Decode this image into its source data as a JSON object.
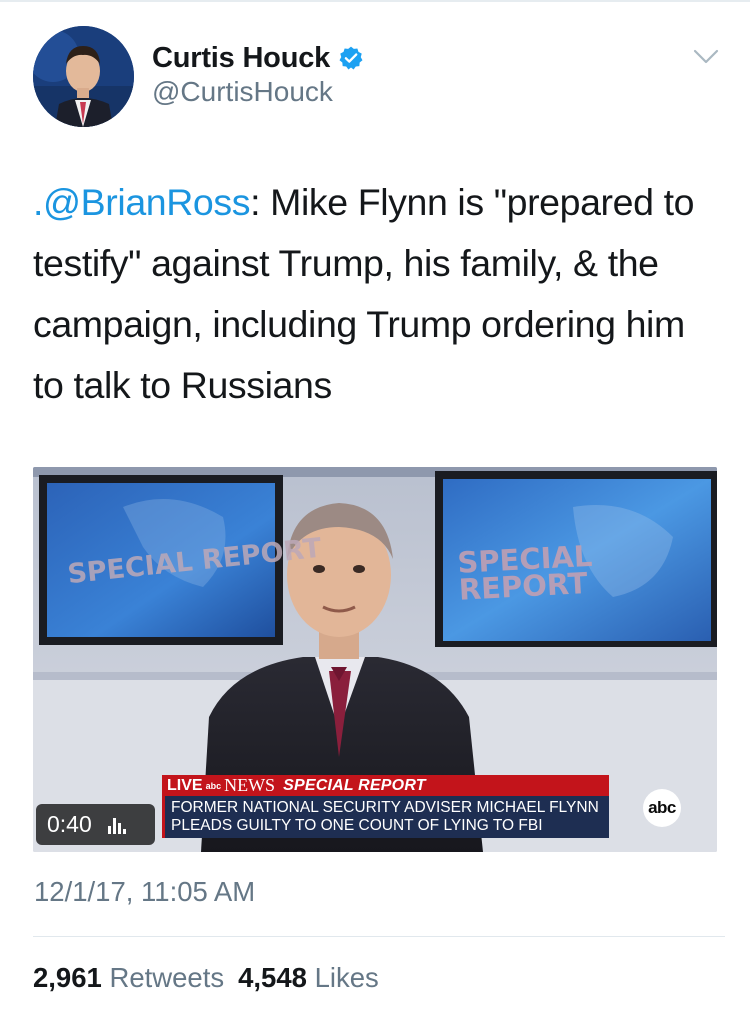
{
  "user": {
    "display_name": "Curtis Houck",
    "handle": "@CurtisHouck",
    "verified": true
  },
  "tweet": {
    "mention": ".@BrianRoss",
    "text": ": Mike Flynn is \"prepared to testify\" against Trump, his family, & the campaign, including Trump ordering him to talk to Russians",
    "timestamp": "12/1/17, 11:05 AM"
  },
  "media": {
    "monitor_text_left": "SPECIAL REPORT",
    "monitor_text_right": "SPECIAL REPORT",
    "lower_third": {
      "live": "LIVE",
      "network_small": "abc",
      "network": "NEWS",
      "segment": "SPECIAL REPORT",
      "line1": "FORMER NATIONAL SECURITY ADVISER MICHAEL FLYNN",
      "line2": "PLEADS GUILTY TO ONE COUNT OF LYING TO FBI"
    },
    "channel_logo": "abc",
    "duration": "0:40",
    "views_icon": "bar-chart-icon"
  },
  "stats": {
    "retweets_count": "2,961",
    "retweets_label": "Retweets",
    "likes_count": "4,548",
    "likes_label": "Likes"
  },
  "colors": {
    "link": "#1b95e0",
    "secondary_text": "#657786",
    "verified": "#1da1f2",
    "news_red": "#c3141b",
    "news_blue": "#1e2e52"
  }
}
